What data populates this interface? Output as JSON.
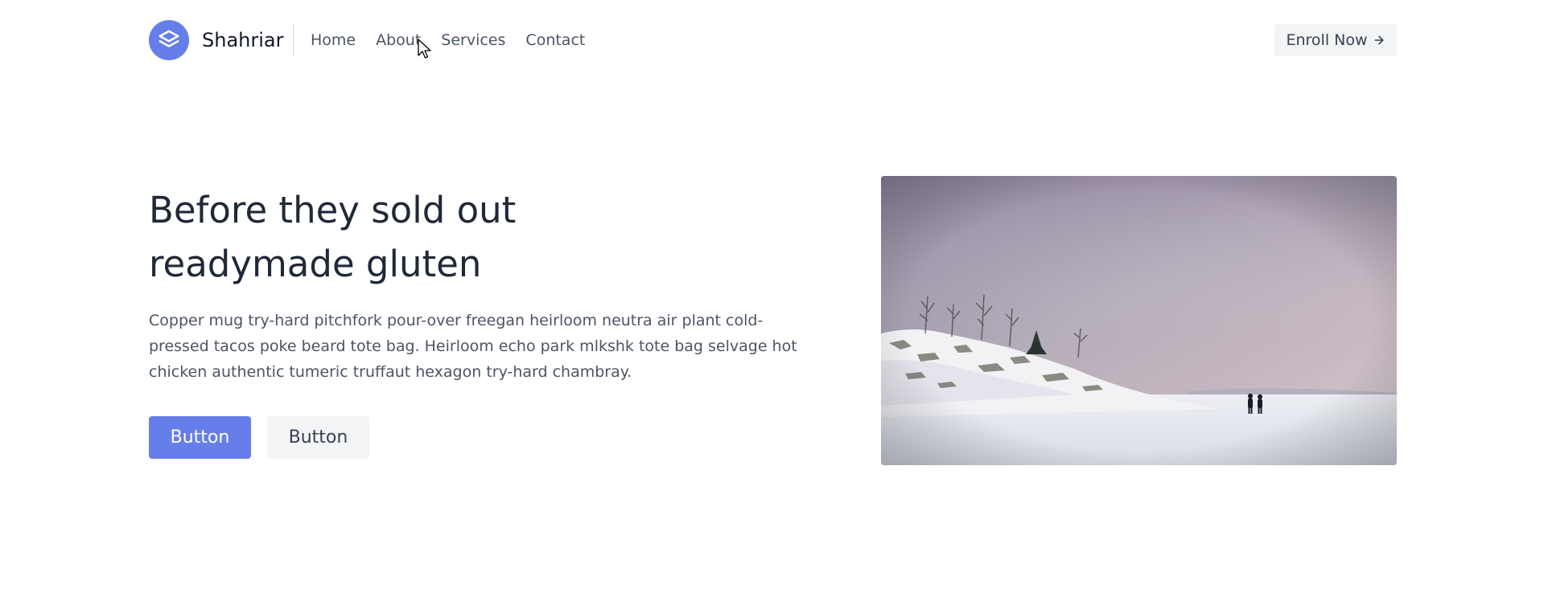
{
  "header": {
    "brand_name": "Shahriar",
    "logo_icon": "layers-icon",
    "nav": [
      "Home",
      "About",
      "Services",
      "Contact"
    ],
    "cta_label": "Enroll Now",
    "cta_icon": "arrow-right-icon"
  },
  "hero": {
    "title_line1": "Before they sold out",
    "title_line2": "readymade gluten",
    "description": "Copper mug try-hard pitchfork pour-over freegan heirloom neutra air plant cold-pressed tacos poke beard tote bag. Heirloom echo park mlkshk tote bag selvage hot chicken authentic tumeric truffaut hexagon try-hard chambray.",
    "primary_button": "Button",
    "secondary_button": "Button",
    "image_subject": "snowy coastline with two people walking"
  },
  "colors": {
    "accent": "#667eea",
    "button_secondary_bg": "#f3f4f6",
    "heading": "#1f2937",
    "body_text": "#4b5563"
  }
}
